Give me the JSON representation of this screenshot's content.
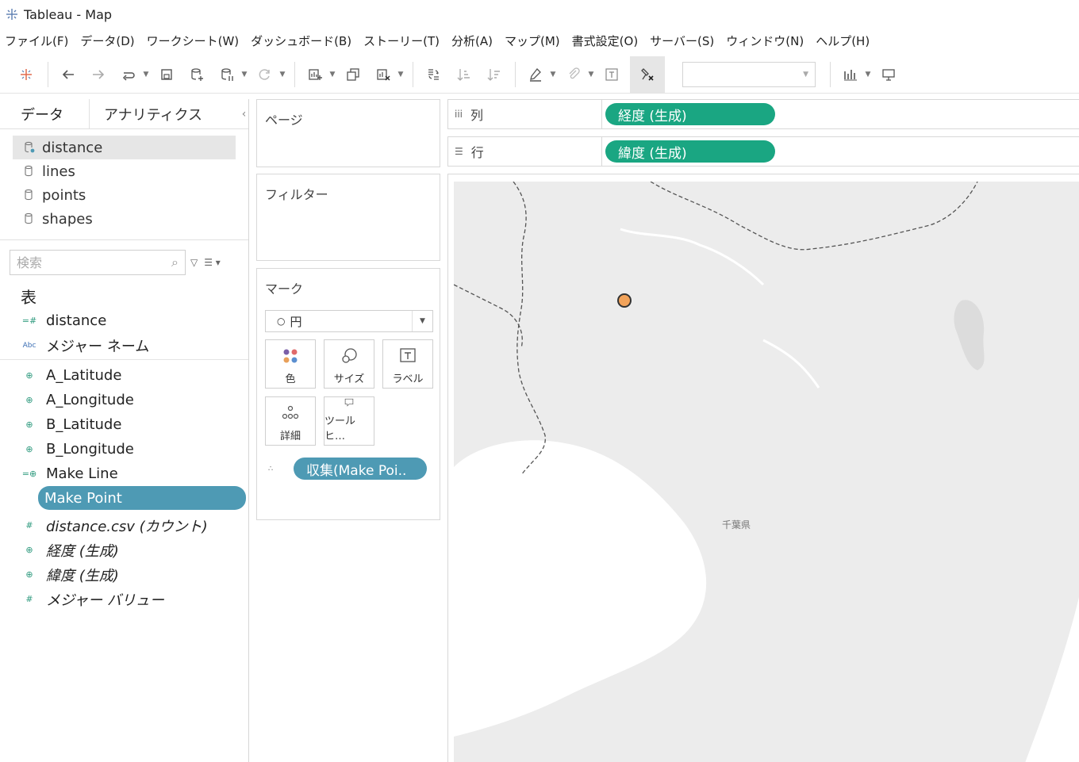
{
  "window": {
    "title": "Tableau - Map"
  },
  "menu": [
    "ファイル(F)",
    "データ(D)",
    "ワークシート(W)",
    "ダッシュボード(B)",
    "ストーリー(T)",
    "分析(A)",
    "マップ(M)",
    "書式設定(O)",
    "サーバー(S)",
    "ウィンドウ(N)",
    "ヘルプ(H)"
  ],
  "data_pane": {
    "tabs": {
      "data": "データ",
      "analytics": "アナリティクス"
    },
    "datasources": [
      "distance",
      "lines",
      "points",
      "shapes"
    ],
    "selected_datasource": "distance",
    "search_placeholder": "検索",
    "section_title": "表",
    "fields_dimensions": [
      {
        "icon": "=#",
        "label": "distance"
      },
      {
        "icon": "Abc",
        "label": "メジャー ネーム"
      }
    ],
    "fields_geo": [
      {
        "icon": "geo",
        "label": "A_Latitude"
      },
      {
        "icon": "geo",
        "label": "A_Longitude"
      },
      {
        "icon": "geo",
        "label": "B_Latitude"
      },
      {
        "icon": "geo",
        "label": "B_Longitude"
      },
      {
        "icon": "=geo",
        "label": "Make Line"
      },
      {
        "icon": "=geo",
        "label": "Make Point",
        "selected": true
      }
    ],
    "fields_measures": [
      {
        "icon": "#",
        "label": "distance.csv (カウント)"
      },
      {
        "icon": "geo",
        "label": "経度 (生成)"
      },
      {
        "icon": "geo",
        "label": "緯度 (生成)"
      },
      {
        "icon": "#",
        "label": "メジャー バリュー"
      }
    ]
  },
  "cards": {
    "pages_title": "ページ",
    "filters_title": "フィルター",
    "marks_title": "マーク",
    "mark_type": "円",
    "mark_buttons": {
      "color": "色",
      "size": "サイズ",
      "label": "ラベル",
      "detail": "詳細",
      "tooltip": "ツールヒ…"
    },
    "mark_field": "収集(Make Poi.."
  },
  "shelves": {
    "columns": {
      "label": "列",
      "pill": "経度 (生成)"
    },
    "rows": {
      "label": "行",
      "pill": "緯度 (生成)"
    }
  },
  "map": {
    "region_label": "千葉県",
    "point_color": "#f2a35a",
    "point_stroke": "#333333"
  },
  "colors": {
    "green_pill": "#1aa682",
    "blue_pill": "#4e9ab4",
    "land": "#ececec",
    "water": "#ffffff"
  }
}
